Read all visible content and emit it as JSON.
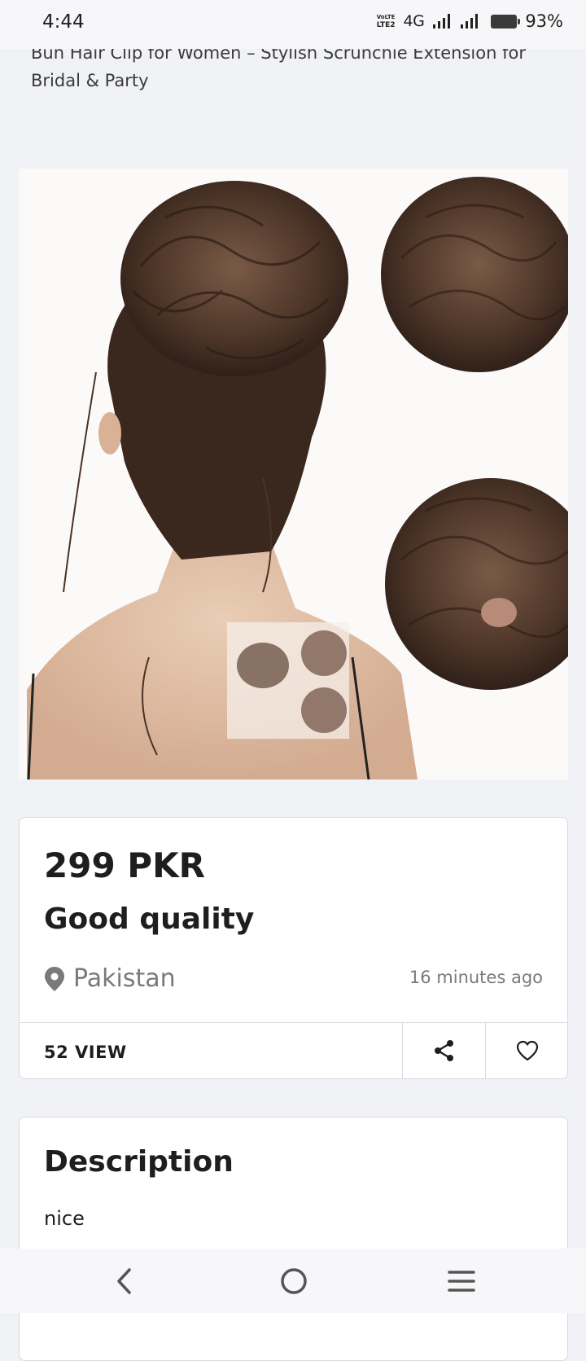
{
  "status_bar": {
    "time": "4:44",
    "volte_top": "VoLTE",
    "volte_bottom": "LTE2",
    "network": "4G",
    "battery": "93%",
    "battery_level": 0.93
  },
  "product": {
    "title": "Bun Hair Clip for Women – Stylish Scrunchie Extension for Bridal & Party",
    "image_icon": "product-photo"
  },
  "listing": {
    "price": "299 PKR",
    "ad_title": "Good quality",
    "location": "Pakistan",
    "posted": "16 minutes ago",
    "views": "52 VIEW",
    "share_icon": "share-icon",
    "favorite_icon": "heart-icon"
  },
  "description": {
    "heading": "Description",
    "body": "nice"
  },
  "navigation": {
    "back_icon": "back-icon",
    "home_icon": "home-icon",
    "menu_icon": "menu-icon"
  },
  "colors": {
    "background": "#f1f2f6",
    "card": "#ffffff",
    "text": "#1e1e1e",
    "muted": "#7a7a7a"
  }
}
